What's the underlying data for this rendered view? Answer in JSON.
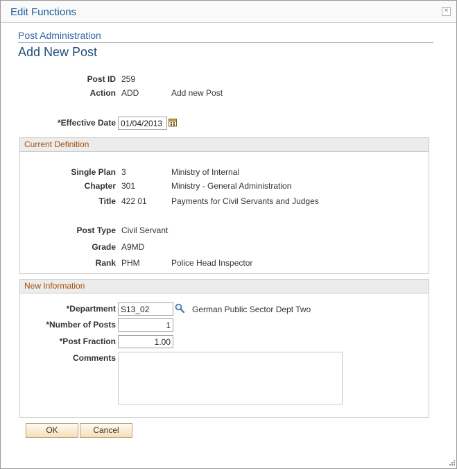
{
  "dialog": {
    "title": "Edit Functions",
    "close_glyph": "×"
  },
  "breadcrumb": "Post Administration",
  "page_title": "Add New Post",
  "header_fields": {
    "post_id_label": "Post ID",
    "post_id_value": "259",
    "action_label": "Action",
    "action_value": "ADD",
    "action_desc": "Add new Post"
  },
  "effective_date": {
    "label": "*Effective Date",
    "value": "01/04/2013"
  },
  "current_definition": {
    "title": "Current Definition",
    "single_plan_label": "Single Plan",
    "single_plan_value": "3",
    "single_plan_desc": "Ministry of Internal",
    "chapter_label": "Chapter",
    "chapter_value": "301",
    "chapter_desc": "Ministry - General Administration",
    "title_label": "Title",
    "title_value": "422 01",
    "title_desc": "Payments for Civil Servants and Judges",
    "post_type_label": "Post Type",
    "post_type_value": "Civil Servant",
    "grade_label": "Grade",
    "grade_value": "A9MD",
    "rank_label": "Rank",
    "rank_value": "PHM",
    "rank_desc": "Police Head Inspector"
  },
  "new_information": {
    "title": "New Information",
    "department_label": "*Department",
    "department_value": "S13_02",
    "department_desc": "German Public Sector Dept Two",
    "num_posts_label": "*Number of Posts",
    "num_posts_value": "1",
    "post_fraction_label": "*Post Fraction",
    "post_fraction_value": "1.00",
    "comments_label": "Comments",
    "comments_value": ""
  },
  "buttons": {
    "ok": "OK",
    "cancel": "Cancel"
  },
  "icons": {
    "calendar": "calendar-icon",
    "lookup": "magnifier-icon",
    "close": "close-icon",
    "resize": "resize-grip-icon"
  }
}
